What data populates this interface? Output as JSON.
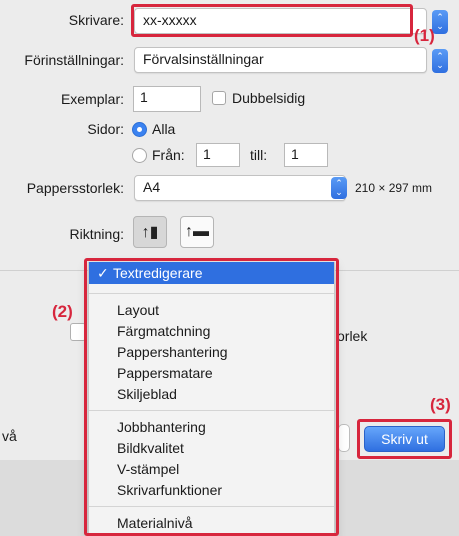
{
  "printer": {
    "label": "Skrivare:",
    "value": "xx-xxxxx"
  },
  "presets": {
    "label": "Förinställningar:",
    "value": "Förvalsinställningar"
  },
  "copies": {
    "label": "Exemplar:",
    "value": "1",
    "duplex_label": "Dubbelsidig"
  },
  "pages": {
    "label": "Sidor:",
    "all_label": "Alla",
    "from_label": "Från:",
    "from_value": "1",
    "to_label": "till:",
    "to_value": "1"
  },
  "paper_size": {
    "label": "Pappersstorlek:",
    "value": "A4",
    "dimensions": "210 × 297 mm"
  },
  "orientation": {
    "label": "Riktning:"
  },
  "menu": {
    "selected": "Textredigerare",
    "group1": [
      "Layout",
      "Färgmatchning",
      "Pappershantering",
      "Pappersmatare",
      "Skiljeblad"
    ],
    "group2": [
      "Jobbhantering",
      "Bildkvalitet",
      "V-stämpel",
      "Skrivarfunktioner"
    ],
    "group3": [
      "Materialnivå"
    ]
  },
  "partial": {
    "right_text": "orlek",
    "left_text": "vå"
  },
  "buttons": {
    "print_label": "Skriv ut"
  },
  "callouts": {
    "one": "(1)",
    "two": "(2)",
    "three": "(3)"
  },
  "colors": {
    "accent": "#2f6fe0",
    "callout": "#d7263d"
  }
}
